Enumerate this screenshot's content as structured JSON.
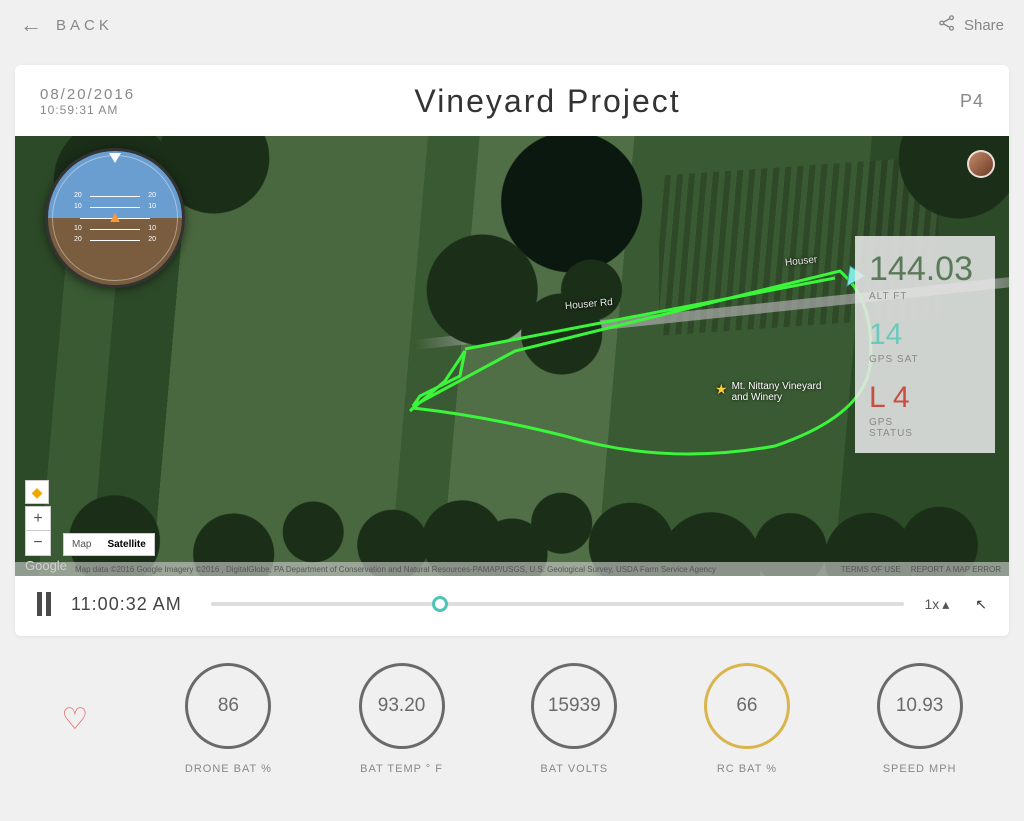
{
  "topbar": {
    "back_label": "BACK",
    "share_label": "Share"
  },
  "header": {
    "date": "08/20/2016",
    "time": "10:59:31 AM",
    "title": "Vineyard Project",
    "drone_model": "P4"
  },
  "attitude": {
    "pitch_marks": [
      "20",
      "10",
      "10",
      "20"
    ]
  },
  "map": {
    "road_label_1": "Houser Rd",
    "road_label_2": "Houser",
    "poi_name": "Mt. Nittany Vineyard\nand Winery",
    "maptype": {
      "map": "Map",
      "satellite": "Satellite"
    },
    "google": "Google",
    "attribution": "Map data ©2016 Google Imagery ©2016 , DigitalGlobe, PA Department of Conservation and Natural Resources-PAMAP/USGS, U.S. Geological Survey, USDA Farm Service Agency",
    "terms": "TERMS OF USE",
    "report": "REPORT A MAP ERROR"
  },
  "telemetry": {
    "alt_value": "144.03",
    "alt_label": "ALT FT",
    "sat_value": "14",
    "sat_label": "GPS SAT",
    "status_value": "L 4",
    "status_label": "GPS\nSTATUS"
  },
  "playback": {
    "time": "11:00:32 AM",
    "speed": "1x",
    "progress_pct": 33
  },
  "metrics": [
    {
      "value": "86",
      "label": "DRONE BAT %",
      "warn": false
    },
    {
      "value": "93.20",
      "label": "BAT TEMP ° F",
      "warn": false
    },
    {
      "value": "15939",
      "label": "BAT VOLTS",
      "warn": false
    },
    {
      "value": "66",
      "label": "RC BAT %",
      "warn": true
    },
    {
      "value": "10.93",
      "label": "SPEED MPH",
      "warn": false
    }
  ]
}
